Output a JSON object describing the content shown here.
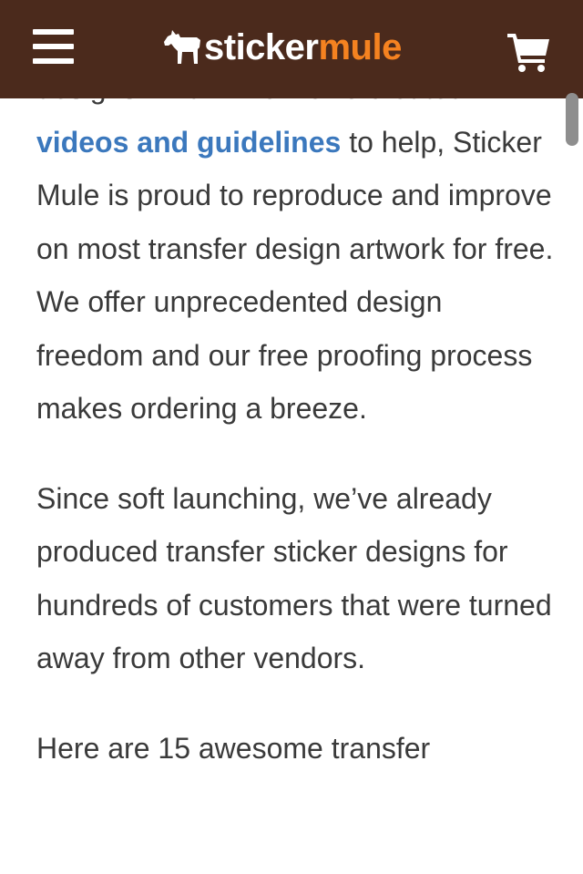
{
  "header": {
    "logo_part1": "sticker",
    "logo_part2": "mule",
    "menu_icon": "hamburger-icon",
    "cart_icon": "shopping-cart-icon",
    "logo_icon": "mule-icon",
    "background": "#4b2a1c",
    "accent": "#f58220"
  },
  "article": {
    "p1_start": "designs. And while we've created ",
    "p1_link": "videos and guidelines",
    "p1_end": " to help, Sticker Mule is proud to reproduce and improve on most transfer design artwork for free. We offer unprecedented design freedom and our free proofing process makes ordering a breeze.",
    "p2": "Since soft launching, we’ve already produced transfer sticker designs for hundreds of customers that were turned away from other vendors.",
    "p3": "Here are 15 awesome transfer",
    "link_color": "#3b78bd",
    "text_color": "#3a3a3a"
  }
}
